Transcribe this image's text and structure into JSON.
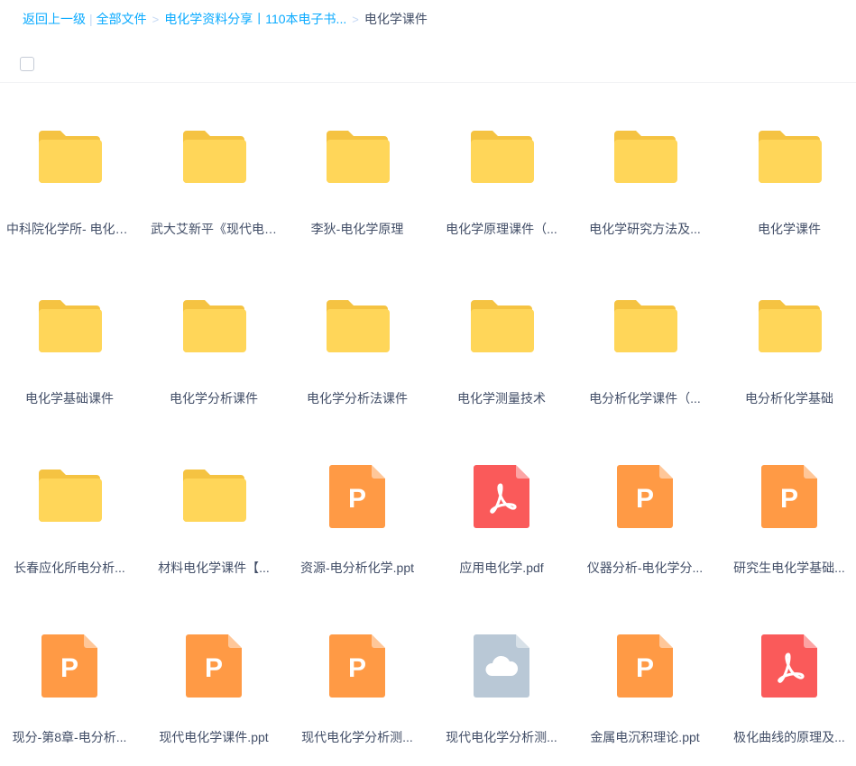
{
  "breadcrumb": {
    "back": "返回上一级",
    "all_files": "全部文件",
    "parent": "电化学资料分享丨110本电子书...",
    "current": "电化学课件"
  },
  "colors": {
    "link": "#09aaff",
    "folder": "#ffd659",
    "folder_tab": "#f5c342",
    "ppt": "#ff9a45",
    "pdf": "#fa5a5a",
    "cloud": "#b9c8d6"
  },
  "files": [
    {
      "name": "中科院化学所- 电化学...",
      "type": "folder",
      "icon": "folder-icon"
    },
    {
      "name": "武大艾新平《现代电化...",
      "type": "folder",
      "icon": "folder-icon"
    },
    {
      "name": "李狄-电化学原理",
      "type": "folder",
      "icon": "folder-icon"
    },
    {
      "name": "电化学原理课件（...",
      "type": "folder",
      "icon": "folder-icon"
    },
    {
      "name": "电化学研究方法及...",
      "type": "folder",
      "icon": "folder-icon"
    },
    {
      "name": "电化学课件",
      "type": "folder",
      "icon": "folder-icon"
    },
    {
      "name": "电化学基础课件",
      "type": "folder",
      "icon": "folder-icon"
    },
    {
      "name": "电化学分析课件",
      "type": "folder",
      "icon": "folder-icon"
    },
    {
      "name": "电化学分析法课件",
      "type": "folder",
      "icon": "folder-icon"
    },
    {
      "name": "电化学测量技术",
      "type": "folder",
      "icon": "folder-icon"
    },
    {
      "name": "电分析化学课件（...",
      "type": "folder",
      "icon": "folder-icon"
    },
    {
      "name": "电分析化学基础",
      "type": "folder",
      "icon": "folder-icon"
    },
    {
      "name": "长春应化所电分析...",
      "type": "folder",
      "icon": "folder-icon"
    },
    {
      "name": "材料电化学课件【...",
      "type": "folder",
      "icon": "folder-icon"
    },
    {
      "name": "资源-电分析化学.ppt",
      "type": "ppt",
      "icon": "ppt-file-icon",
      "glyph": "P"
    },
    {
      "name": "应用电化学.pdf",
      "type": "pdf",
      "icon": "pdf-file-icon"
    },
    {
      "name": "仪器分析-电化学分...",
      "type": "ppt",
      "icon": "ppt-file-icon",
      "glyph": "P"
    },
    {
      "name": "研究生电化学基础...",
      "type": "ppt",
      "icon": "ppt-file-icon",
      "glyph": "P"
    },
    {
      "name": "现分-第8章-电分析...",
      "type": "ppt",
      "icon": "ppt-file-icon",
      "glyph": "P"
    },
    {
      "name": "现代电化学课件.ppt",
      "type": "ppt",
      "icon": "ppt-file-icon",
      "glyph": "P"
    },
    {
      "name": "现代电化学分析测...",
      "type": "ppt",
      "icon": "ppt-file-icon",
      "glyph": "P"
    },
    {
      "name": "现代电化学分析测...",
      "type": "cloud",
      "icon": "cloud-file-icon"
    },
    {
      "name": "金属电沉积理论.ppt",
      "type": "ppt",
      "icon": "ppt-file-icon",
      "glyph": "P"
    },
    {
      "name": "极化曲线的原理及...",
      "type": "pdf",
      "icon": "pdf-file-icon"
    }
  ]
}
